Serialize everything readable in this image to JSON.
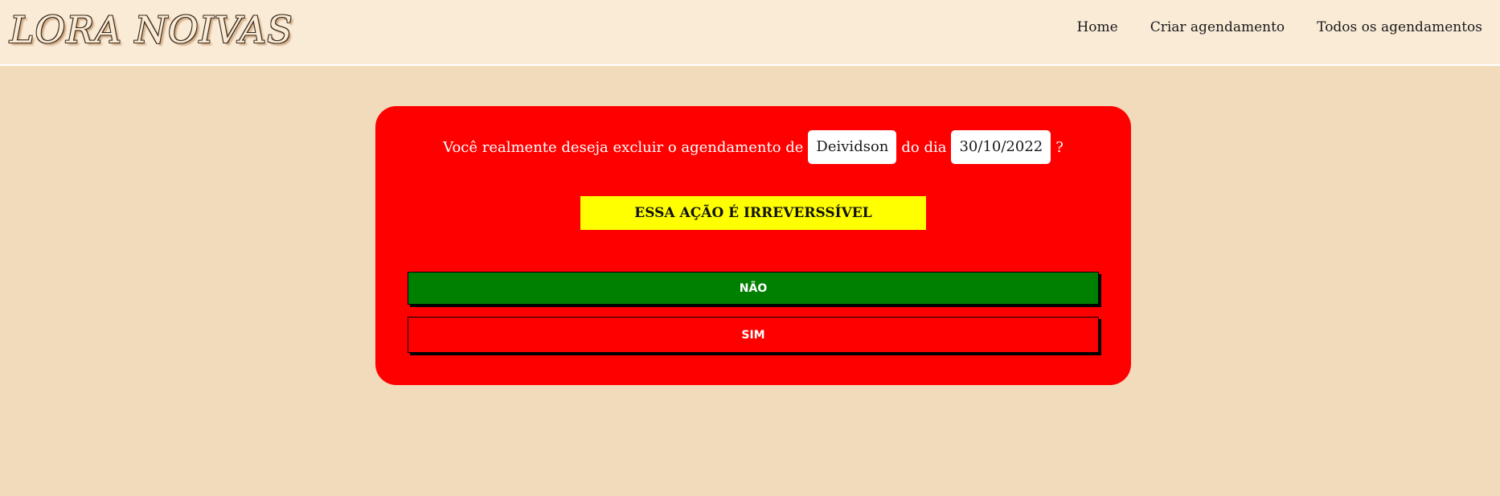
{
  "header": {
    "logo": "LORA NOIVAS",
    "nav": [
      "Home",
      "Criar agendamento",
      "Todos os agendamentos"
    ]
  },
  "dialog": {
    "question_prefix": "Você realmente deseja excluir o agendamento de",
    "client_name": "Deividson",
    "middle_text": "do dia",
    "date": "30/10/2022",
    "question_suffix": "?",
    "warning": "ESSA AÇÃO É IRREVERSSÍVEL",
    "no_label": "NÃO",
    "yes_label": "SIM"
  },
  "colors": {
    "page_background": "#f1dbbb",
    "topbar_background": "#faebd7",
    "card_background": "#ff0000",
    "warning_background": "#ffff00",
    "no_button": "#008000",
    "yes_button": "#ff0000"
  }
}
